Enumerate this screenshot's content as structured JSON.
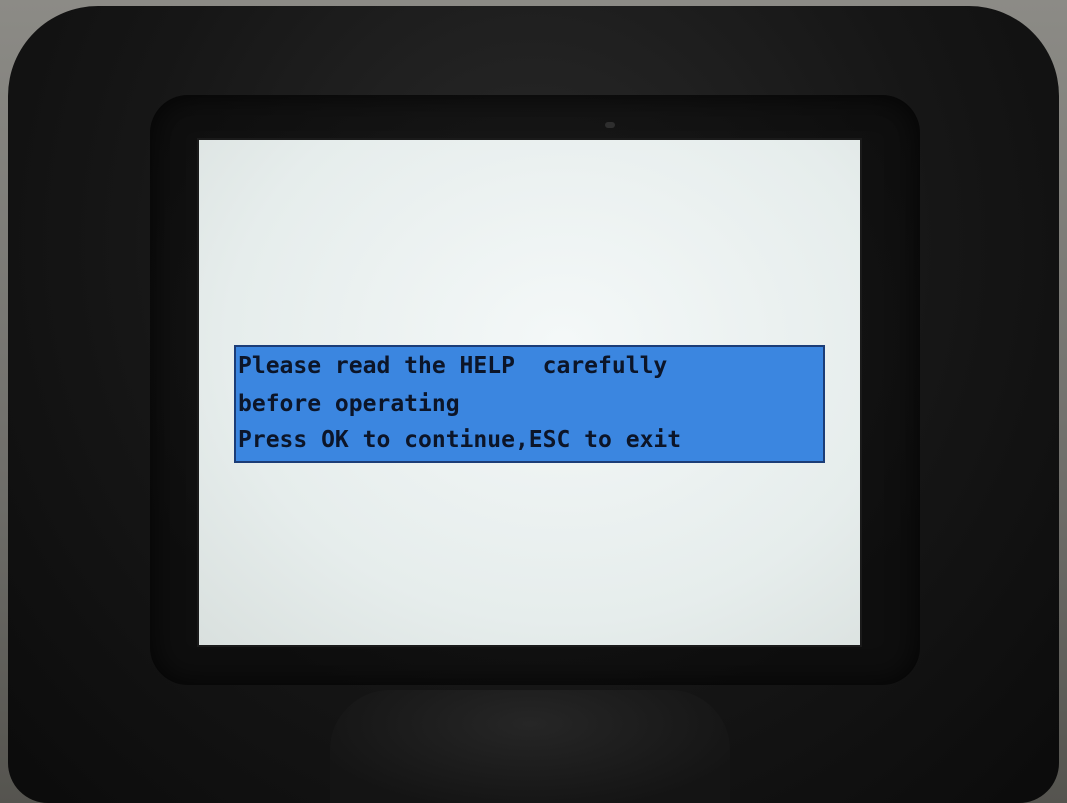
{
  "dialog": {
    "lines": [
      "Please read the HELP  carefully",
      "before operating",
      "Press OK to continue,ESC to exit"
    ]
  },
  "colors": {
    "dialog_background": "#3b86e0",
    "dialog_border": "#1c3d77",
    "dialog_text": "#0c1528",
    "screen_background": "#eef3f2",
    "device_body": "#161616"
  }
}
